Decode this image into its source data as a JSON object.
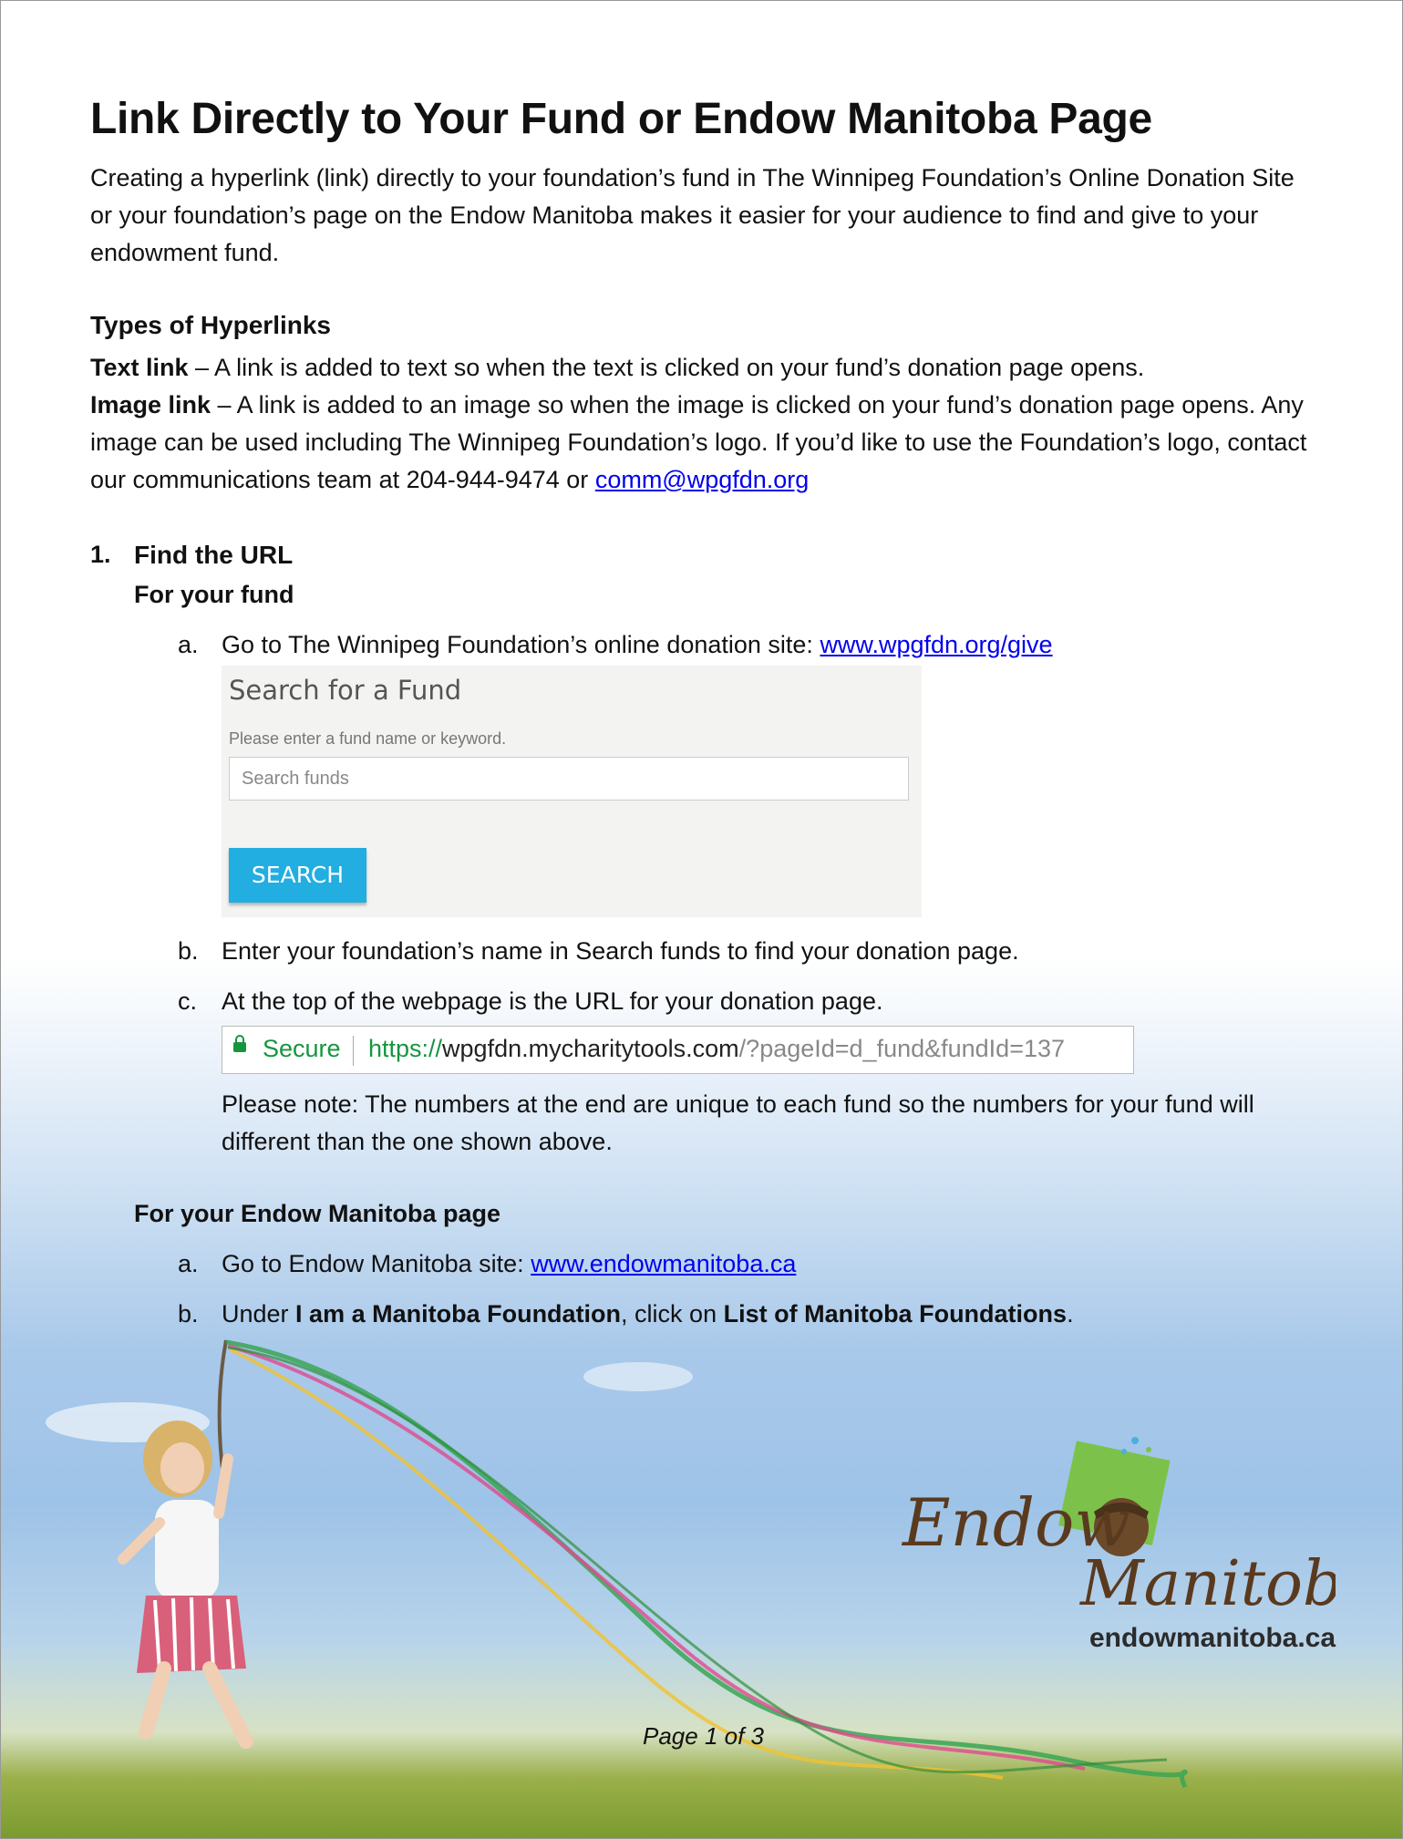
{
  "title": "Link Directly to Your Fund or Endow Manitoba Page",
  "intro": "Creating a hyperlink (link) directly to your foundation’s fund in The Winnipeg Foundation’s Online Donation Site or your foundation’s page on the Endow Manitoba makes it easier for your audience to find and give to your endowment fund.",
  "types_heading": "Types of Hyperlinks",
  "text_link": {
    "label": "Text link",
    "desc": " – A link is added to text so when the text is clicked on your fund’s donation page opens."
  },
  "image_link": {
    "label": "Image link",
    "desc": " – A link is added to an image so when the image is clicked on your fund’s donation page opens. Any image can be used including The Winnipeg Foundation’s logo. If you’d like to use the Foundation’s logo, contact our communications team at 204-944-9474 or ",
    "email": "comm@wpgfdn.org"
  },
  "step1": {
    "num": "1.",
    "heading": "Find the URL",
    "for_fund": "For your fund",
    "a_letter": "a.",
    "a_text": "Go to The Winnipeg Foundation’s online donation site: ",
    "a_link": "www.wpgfdn.org/give",
    "search": {
      "title": "Search for a Fund",
      "hint": "Please enter a fund name or keyword.",
      "placeholder": "Search funds",
      "button": "SEARCH"
    },
    "b_letter": "b.",
    "b_text": "Enter your foundation’s name in Search funds to find your donation page.",
    "c_letter": "c.",
    "c_text": "At the top of the webpage is the URL for your donation page.",
    "urlbar": {
      "secure": "Secure",
      "scheme": "https://",
      "host": "wpgfdn.mycharitytools.com",
      "rest": "/?pageId=d_fund&fundId=137"
    },
    "note": "Please note: The numbers at the end are unique to each fund so the numbers for your fund will different than the one shown above.",
    "for_endow": "For your Endow Manitoba page",
    "ea_letter": "a.",
    "ea_text": "Go to Endow Manitoba site: ",
    "ea_link": "www.endowmanitoba.ca",
    "eb_letter": "b.",
    "eb_pre": "Under ",
    "eb_bold1": "I am a Manitoba Foundation",
    "eb_mid": ", click on ",
    "eb_bold2": "List of Manitoba Foundations",
    "eb_end": "."
  },
  "logo": {
    "word1": "Endow",
    "word2": "Manitoba",
    "site": "endowmanitoba.ca"
  },
  "footer": "Page 1 of 3"
}
